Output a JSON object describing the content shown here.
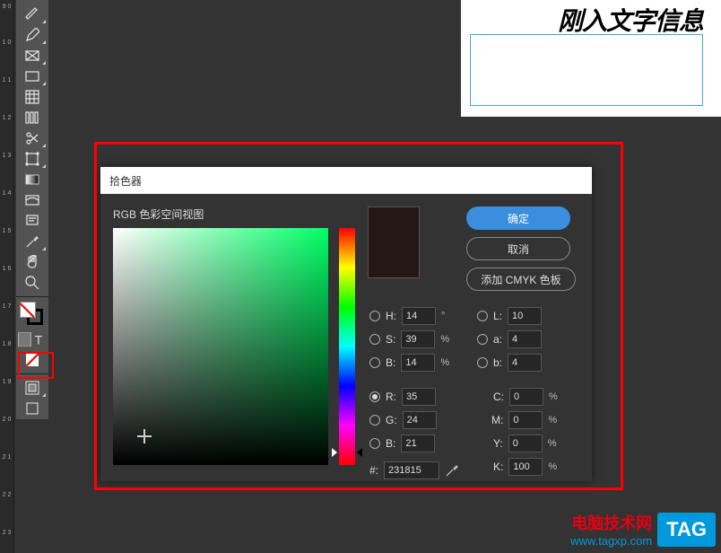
{
  "canvas": {
    "text": "刚入文字信息"
  },
  "dialog": {
    "title": "拾色器",
    "subtitle": "RGB 色彩空间视图",
    "buttons": {
      "ok": "确定",
      "cancel": "取消",
      "cmyk": "添加 CMYK 色板"
    },
    "hsb": {
      "h_label": "H:",
      "h": "14",
      "h_unit": "°",
      "s_label": "S:",
      "s": "39",
      "s_unit": "%",
      "b_label": "B:",
      "b": "14",
      "b_unit": "%"
    },
    "lab": {
      "l_label": "L:",
      "l": "10",
      "a_label": "a:",
      "a": "4",
      "b_label": "b:",
      "b": "4"
    },
    "rgb": {
      "r_label": "R:",
      "r": "35",
      "g_label": "G:",
      "g": "24",
      "b_label": "B:",
      "b": "21"
    },
    "cmyk": {
      "c_label": "C:",
      "c": "0",
      "m_label": "M:",
      "m": "0",
      "y_label": "Y:",
      "y": "0",
      "k_label": "K:",
      "k": "100",
      "unit": "%"
    },
    "hex_label": "#:",
    "hex": "231815"
  },
  "ruler": {
    "t1": "9 0",
    "t2": "1 0",
    "t3": "1 1",
    "t4": "1 2",
    "t5": "1 3",
    "t6": "1 4",
    "t7": "1 5",
    "t8": "1 6",
    "t9": "1 7",
    "t10": "1 8",
    "t11": "1 9",
    "t12": "2 0",
    "t13": "2 1",
    "t14": "2 2",
    "t15": "2 3"
  },
  "watermark": {
    "cn": "电脑技术网",
    "url": "www.tagxp.com",
    "tag": "TAG"
  }
}
